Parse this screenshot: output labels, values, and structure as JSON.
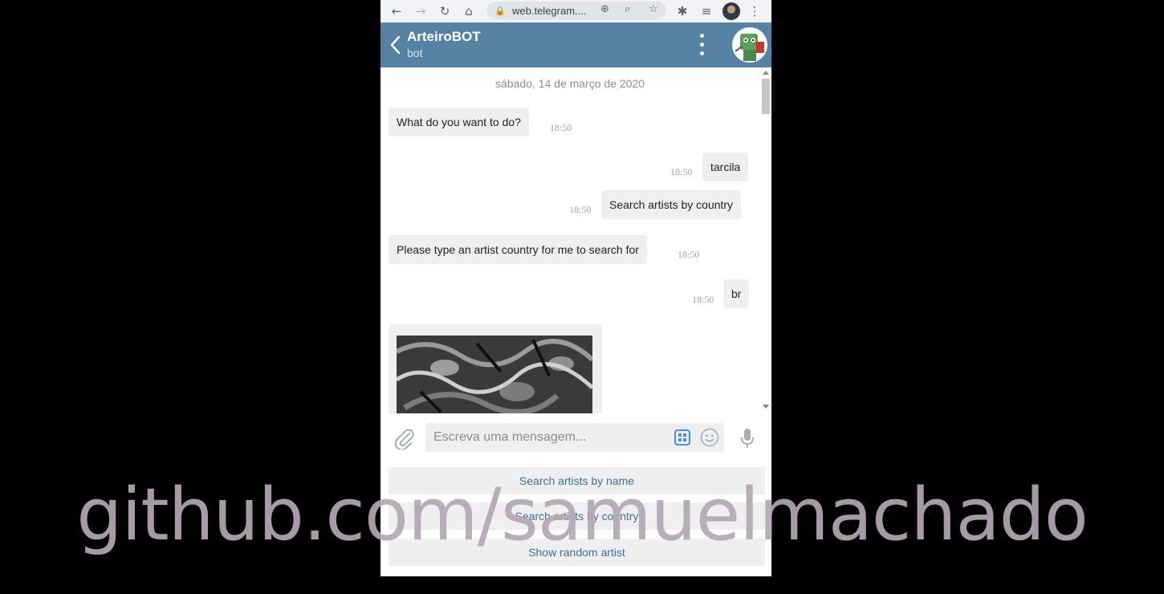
{
  "browser": {
    "url": "web.telegram...."
  },
  "chat_header": {
    "title": "ArteiroBOT",
    "subtitle": "bot"
  },
  "chat": {
    "date": "sábado, 14 de março de 2020",
    "messages": [
      {
        "text": "What do you want to do?",
        "time": "18:50",
        "direction": "incoming"
      },
      {
        "text": "tarcila",
        "time": "18:50",
        "direction": "outgoing"
      },
      {
        "text": "Search artists by country",
        "time": "18:50",
        "direction": "outgoing"
      },
      {
        "text": "Please type an artist country for me to search for",
        "time": "18:50",
        "direction": "incoming"
      },
      {
        "text": "br",
        "time": "18:50",
        "direction": "outgoing"
      }
    ]
  },
  "composer": {
    "placeholder": "Escreva uma mensagem..."
  },
  "bot_keyboard": {
    "buttons": [
      "Search artists by name",
      "Search artists by country",
      "Show random artist"
    ]
  },
  "watermark": "github.com/samuelmachado",
  "colors": {
    "header": "#5682a3",
    "bubble": "#efefef",
    "keyboard_text": "#3d6f98"
  }
}
